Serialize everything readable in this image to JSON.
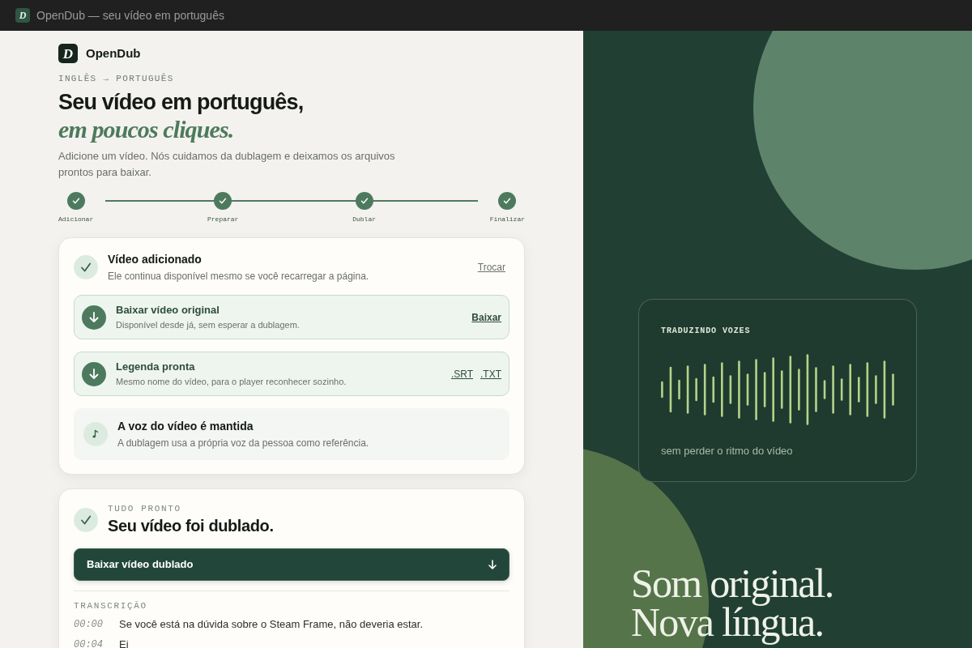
{
  "window": {
    "icon_letter": "D",
    "title": "OpenDub — seu vídeo em português"
  },
  "brand": {
    "logo_letter": "D",
    "name": "OpenDub"
  },
  "hero": {
    "eyebrow": "INGLÊS → PORTUGUÊS",
    "title": "Seu vídeo em português,",
    "title_accent": "em poucos cliques.",
    "description": "Adicione um vídeo. Nós cuidamos da dublagem e deixamos os arquivos prontos para baixar."
  },
  "steps": [
    {
      "label": "Adicionar",
      "done": true
    },
    {
      "label": "Preparar",
      "done": true
    },
    {
      "label": "Dublar",
      "done": true
    },
    {
      "label": "Finalizar",
      "done": true
    }
  ],
  "upload_card": {
    "title": "Vídeo adicionado",
    "subtitle": "Ele continua disponível mesmo se você recarregar a página.",
    "action": "Trocar",
    "items": [
      {
        "kind": "download",
        "title": "Baixar vídeo original",
        "subtitle": "Disponível desde já, sem esperar a dublagem.",
        "links": [
          {
            "label": "Baixar",
            "primary": true
          }
        ]
      },
      {
        "kind": "download",
        "title": "Legenda pronta",
        "subtitle": "Mesmo nome do vídeo, para o player reconhecer sozinho.",
        "links": [
          {
            "label": ".SRT",
            "primary": false
          },
          {
            "label": ".TXT",
            "primary": false
          }
        ]
      },
      {
        "kind": "info",
        "title": "A voz do vídeo é mantida",
        "subtitle": "A dublagem usa a própria voz da pessoa como referência."
      }
    ]
  },
  "result_card": {
    "eyebrow": "TUDO PRONTO",
    "title": "Seu vídeo foi dublado.",
    "button": "Baixar vídeo dublado",
    "transcript_heading": "TRANSCRIÇÃO",
    "transcript": [
      {
        "time": "00:00",
        "text": "Se você está na dúvida sobre o Steam Frame, não deveria estar."
      },
      {
        "time": "00:04",
        "text": "Ei"
      }
    ]
  },
  "side_panel": {
    "card": {
      "eyebrow": "TRADUZINDO VOZES",
      "caption": "sem perder o ritmo do vídeo"
    },
    "headline": [
      "Som original.",
      "Nova língua."
    ]
  }
}
